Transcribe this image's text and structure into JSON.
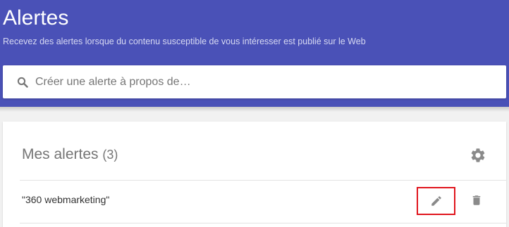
{
  "header": {
    "title": "Alertes",
    "subtitle": "Recevez des alertes lorsque du contenu susceptible de vous intéresser est publié sur le Web",
    "background_color": "#4a51b7"
  },
  "search": {
    "placeholder": "Créer une alerte à propos de…",
    "value": "",
    "icon": "search-icon"
  },
  "alerts_card": {
    "title": "Mes alertes",
    "count": "(3)",
    "settings_icon": "gear-icon",
    "items": [
      {
        "query": "\"360 webmarketing\"",
        "edit_icon": "pencil-icon",
        "delete_icon": "trash-icon",
        "edit_highlight_color": "#e0141c"
      }
    ]
  }
}
